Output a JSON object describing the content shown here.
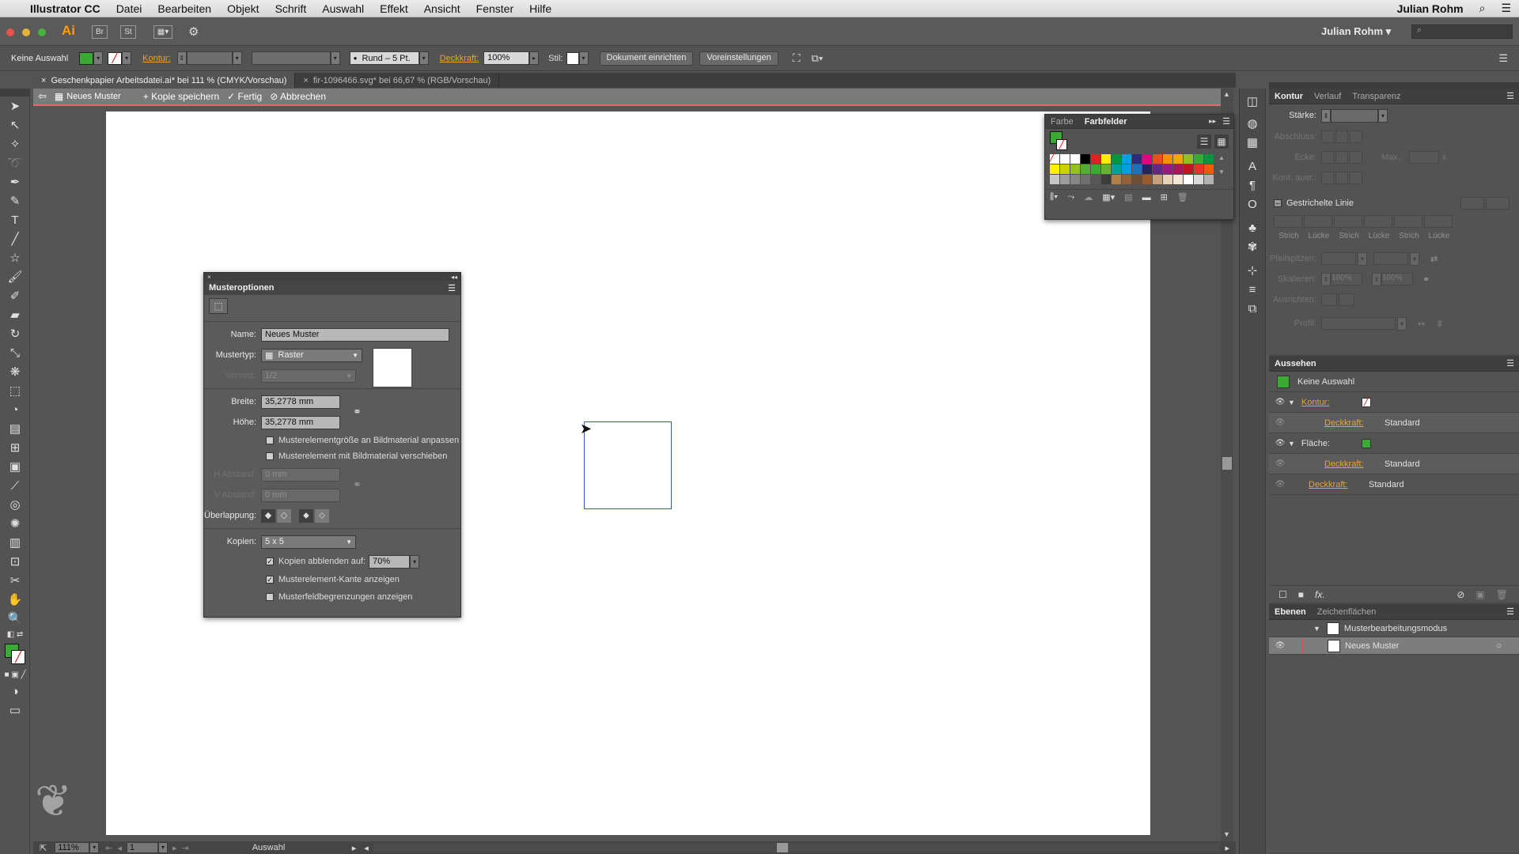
{
  "menubar": {
    "app_name": "Illustrator CC",
    "items": [
      "Datei",
      "Bearbeiten",
      "Objekt",
      "Schrift",
      "Auswahl",
      "Effekt",
      "Ansicht",
      "Fenster",
      "Hilfe"
    ],
    "user": "Julian Rohm"
  },
  "appbar": {
    "logo": "Ai",
    "bridge": "Br",
    "stock": "St",
    "user": "Julian Rohm"
  },
  "control": {
    "selection": "Keine Auswahl",
    "kontur_label": "Kontur:",
    "brush": "Rund – 5 Pt.",
    "deckkraft_label": "Deckkraft:",
    "deckkraft_value": "100%",
    "stil_label": "Stil:",
    "document_button": "Dokument einrichten",
    "prefs_button": "Voreinstellungen"
  },
  "tabs": [
    {
      "label": "Geschenkpapier Arbeitsdatei.ai* bei 111 % (CMYK/Vorschau)",
      "active": true
    },
    {
      "label": "fir-1096466.svg* bei 66,67 % (RGB/Vorschau)",
      "active": false
    }
  ],
  "isolation": {
    "name": "Neues Muster",
    "save_copy": "Kopie speichern",
    "done": "Fertig",
    "cancel": "Abbrechen"
  },
  "status": {
    "zoom": "111%",
    "page": "1",
    "mode": "Auswahl"
  },
  "farb_panel": {
    "tab_farbe": "Farbe",
    "tab_farbfelder": "Farbfelder",
    "swatch_colors": [
      "#ffffff",
      "#ffffff",
      "#ffffff",
      "#000000",
      "#e31e24",
      "#ffed00",
      "#00963f",
      "#00a0e3",
      "#2c2a7a",
      "#e5007d",
      "#e94e1b",
      "#f39200",
      "#f7a600",
      "#95c11f",
      "#3aaa35",
      "#009640",
      "#fff200",
      "#cbd300",
      "#95c11f",
      "#52ae32",
      "#3aaa35",
      "#65b32e",
      "#00a19a",
      "#009ee0",
      "#1d71b8",
      "#29235c",
      "#662483",
      "#951b81",
      "#a3195b",
      "#be1622",
      "#e6332a",
      "#ea5b0c",
      "#c6c6c6",
      "#9d9d9d",
      "#878787",
      "#706f6f",
      "#575756",
      "#3c3c3b",
      "#b17f4a",
      "#936037",
      "#6f4e37",
      "#9b5a2b",
      "#c8a27a",
      "#e6d5b8",
      "#f6e8d5",
      "#ffffff",
      "#dadada",
      "#b2b2b2"
    ]
  },
  "kontur_panel": {
    "tabs": [
      "Kontur",
      "Verlauf",
      "Transparenz"
    ],
    "staerke": "Stärke:",
    "abschluss": "Abschluss:",
    "ecke": "Ecke:",
    "max": "Max.:",
    "max_unit": "x",
    "kont_ausr": "Kont. ausr.:",
    "gestrichelte": "Gestrichelte Linie",
    "dash_labels": [
      "Strich",
      "Lücke",
      "Strich",
      "Lücke",
      "Strich",
      "Lücke"
    ],
    "pfeilspitzen": "Pfeilspitzen:",
    "skalieren": "Skalieren:",
    "skalieren_value": "100%",
    "ausrichten": "Ausrichten:",
    "profil": "Profil:"
  },
  "aussehen_panel": {
    "title": "Aussehen",
    "selection": "Keine Auswahl",
    "kontur": "Kontur:",
    "deckkraft": "Deckkraft:",
    "standard": "Standard",
    "flaeche": "Fläche:",
    "fx": "fx."
  },
  "ebenen_panel": {
    "tabs": [
      "Ebenen",
      "Zeichenflächen"
    ],
    "layers": [
      "Musterbearbeitungsmodus",
      "Neues Muster"
    ]
  },
  "muster": {
    "title": "Musteroptionen",
    "name_label": "Name:",
    "name_value": "Neues Muster",
    "typ_label": "Mustertyp:",
    "typ_value": "Raster",
    "versatz_label": "Versatz:",
    "versatz_value": "1/2",
    "breite_label": "Breite:",
    "breite_value": "35,2778 mm",
    "hoehe_label": "Höhe:",
    "hoehe_value": "35,2778 mm",
    "cb1": "Musterelementgröße an Bildmaterial anpassen",
    "cb2": "Musterelement mit Bildmaterial verschieben",
    "habstand_label": "H Abstand:",
    "habstand_value": "0 mm",
    "vabstand_label": "V Abstand:",
    "vabstand_value": "0 mm",
    "ueberlappung_label": "Überlappung:",
    "kopien_label": "Kopien:",
    "kopien_value": "5 x 5",
    "cb3": "Kopien abblenden auf:",
    "cb3_value": "70%",
    "cb4": "Musterelement-Kante anzeigen",
    "cb5": "Musterfeldbegrenzungen anzeigen"
  }
}
